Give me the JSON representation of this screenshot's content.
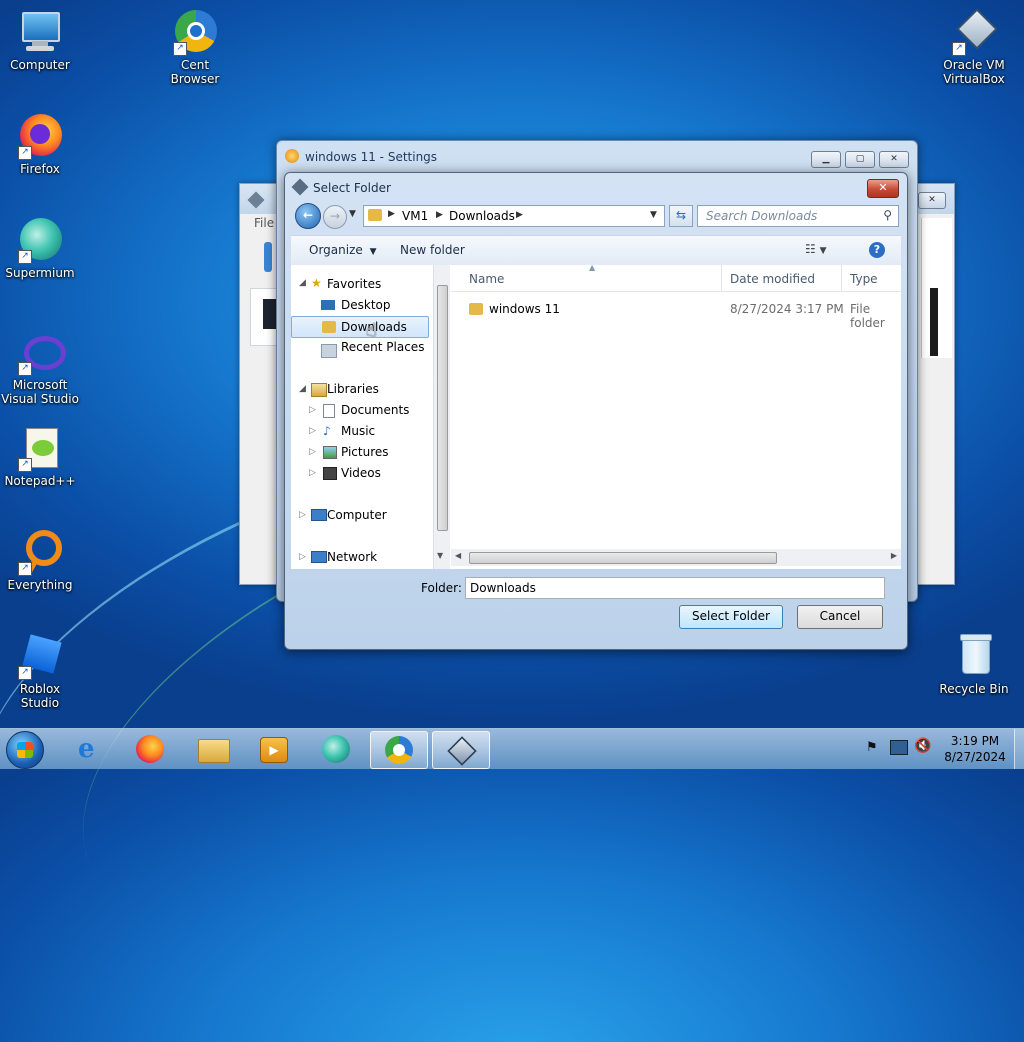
{
  "desktop": {
    "icons": [
      {
        "label": "Computer"
      },
      {
        "label": "Cent Browser"
      },
      {
        "label": "Firefox"
      },
      {
        "label": "Supermium"
      },
      {
        "label": "Microsoft Visual Studio"
      },
      {
        "label": "Notepad++"
      },
      {
        "label": "Everything"
      },
      {
        "label": "Roblox Studio"
      },
      {
        "label": "Oracle VM VirtualBox"
      },
      {
        "label": "Recycle Bin"
      }
    ]
  },
  "back_window": {
    "menu_file": "File"
  },
  "settings_window": {
    "title": "windows 11 - Settings"
  },
  "dialog": {
    "title": "Select Folder",
    "breadcrumb": [
      "VM1",
      "Downloads"
    ],
    "search_placeholder": "Search Downloads",
    "toolbar": {
      "organize": "Organize",
      "new_folder": "New folder"
    },
    "nav": {
      "favorites": "Favorites",
      "favorites_items": [
        "Desktop",
        "Downloads",
        "Recent Places"
      ],
      "libraries": "Libraries",
      "libraries_items": [
        "Documents",
        "Music",
        "Pictures",
        "Videos"
      ],
      "computer": "Computer",
      "network": "Network"
    },
    "columns": {
      "name": "Name",
      "date": "Date modified",
      "type": "Type"
    },
    "files": [
      {
        "name": "windows 11",
        "date": "8/27/2024 3:17 PM",
        "type": "File folder"
      }
    ],
    "folder_label": "Folder:",
    "folder_value": "Downloads",
    "select_button": "Select Folder",
    "cancel_button": "Cancel"
  },
  "taskbar": {
    "time": "3:19 PM",
    "date": "8/27/2024"
  }
}
